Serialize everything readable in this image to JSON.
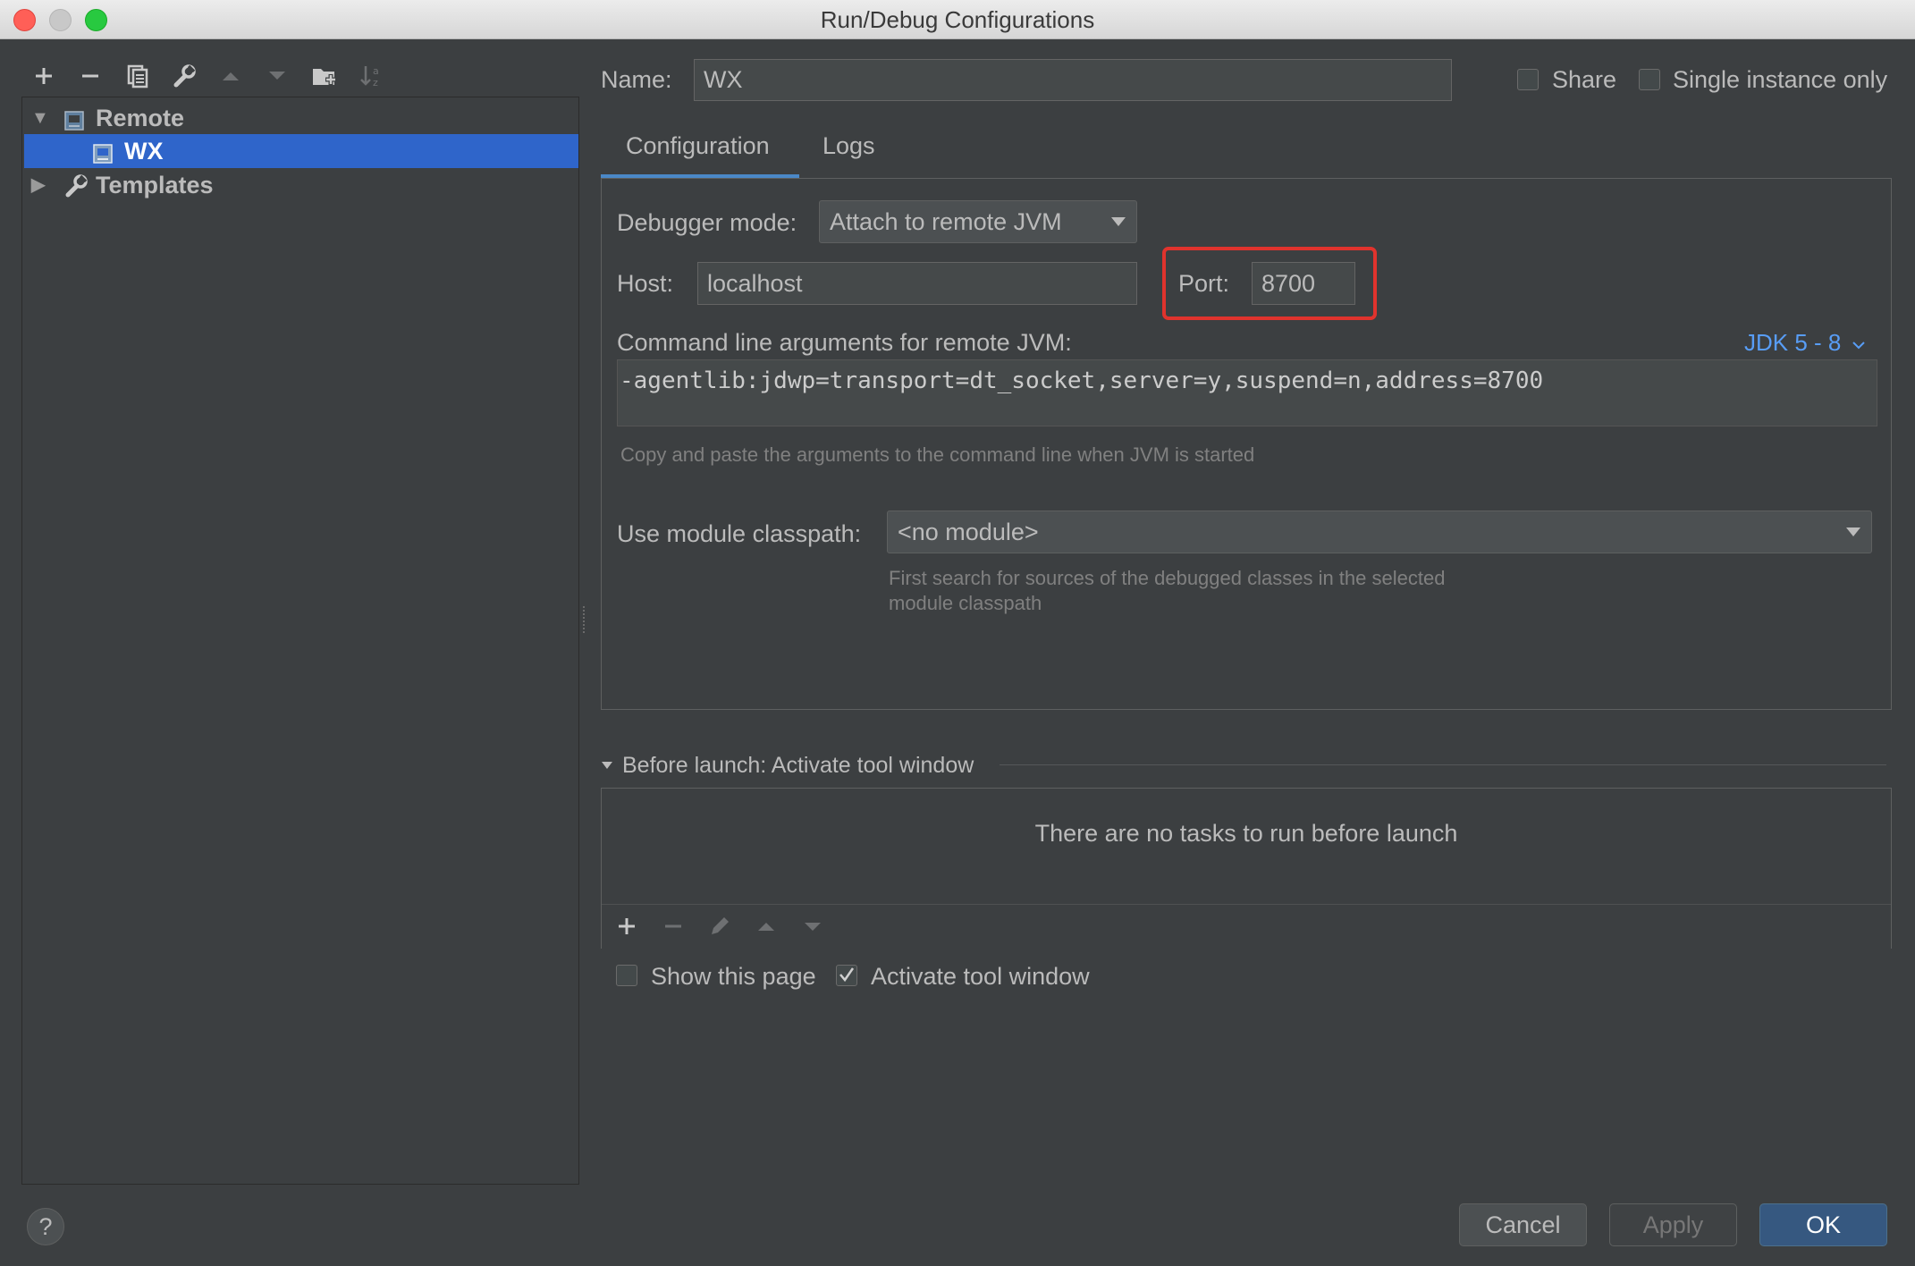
{
  "window": {
    "title": "Run/Debug Configurations"
  },
  "toolbar": {
    "icons": [
      "add-icon",
      "remove-icon",
      "copy-icon",
      "wrench-icon",
      "move-up-icon",
      "move-down-icon",
      "folder-add-icon",
      "sort-icon"
    ]
  },
  "tree": {
    "items": [
      {
        "label": "Remote",
        "expanded": true,
        "icon": "remote-config-icon"
      },
      {
        "label": "WX",
        "selected": true,
        "icon": "remote-config-icon"
      },
      {
        "label": "Templates",
        "expanded": false,
        "icon": "wrench-icon"
      }
    ]
  },
  "name_row": {
    "label": "Name:",
    "value": "WX",
    "share_label": "Share",
    "share_checked": false,
    "single_instance_label": "Single instance only",
    "single_instance_checked": false
  },
  "tabs": [
    {
      "label": "Configuration",
      "active": true
    },
    {
      "label": "Logs",
      "active": false
    }
  ],
  "config": {
    "debugger_mode_label": "Debugger mode:",
    "debugger_mode_value": "Attach to remote JVM",
    "host_label": "Host:",
    "host_value": "localhost",
    "port_label": "Port:",
    "port_value": "8700",
    "cmd_label": "Command line arguments for remote JVM:",
    "jdk_link": "JDK 5 - 8",
    "cmd_value": "-agentlib:jdwp=transport=dt_socket,server=y,suspend=n,address=8700",
    "cmd_hint": "Copy and paste the arguments to the command line when JVM is started",
    "module_label": "Use module classpath:",
    "module_value": "<no module>",
    "module_hint_1": "First search for sources of the debugged classes in the selected",
    "module_hint_2": "module classpath"
  },
  "before_launch": {
    "title": "Before launch: Activate tool window",
    "empty_text": "There are no tasks to run before launch",
    "toolbar_icons": [
      "add-icon",
      "remove-icon",
      "edit-icon",
      "move-up-icon",
      "move-down-icon"
    ]
  },
  "options": {
    "show_page_label": "Show this page",
    "show_page_checked": false,
    "activate_label": "Activate tool window",
    "activate_checked": true
  },
  "buttons": {
    "help": "?",
    "cancel": "Cancel",
    "apply": "Apply",
    "ok": "OK"
  },
  "colors": {
    "background": "#3c3f41",
    "selection": "#2f65ca",
    "primary_button": "#365880",
    "highlight_box": "#e0332d",
    "link": "#589df6"
  }
}
